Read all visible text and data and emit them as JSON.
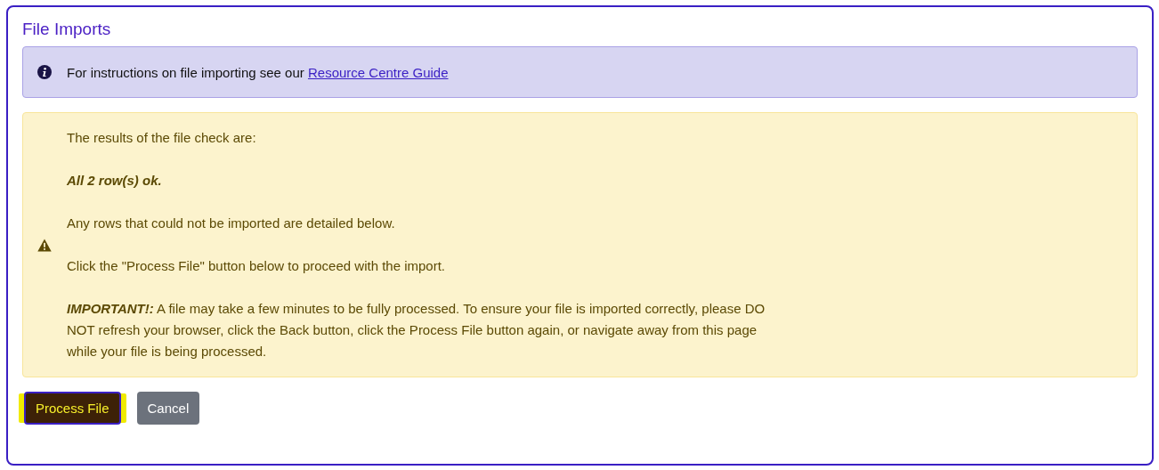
{
  "panel": {
    "title": "File Imports"
  },
  "info_alert": {
    "text": "For instructions on file importing see our",
    "link": "Resource Centre Guide"
  },
  "warning_alert": {
    "paragraphs": [
      {
        "kind": "plain",
        "text": "The results of the file check are:"
      },
      {
        "kind": "emphasis",
        "text": "All 2 row(s) ok."
      },
      {
        "kind": "plain",
        "text": "Any rows that could not be imported are detailed below."
      },
      {
        "kind": "plain",
        "text": "Click the \"Process File\" button below to proceed with the import."
      },
      {
        "kind": "plain",
        "text": "**IMPORTANT!:** A file may take a few minutes to be fully processed. To ensure your file is imported correctly, please DO NOT refresh your browser, click the Back button, click the Process File button again, or navigate away from this page while your file is being processed."
      }
    ]
  },
  "buttons": [
    {
      "kind": "primary",
      "label": "Process File",
      "focused": true
    },
    {
      "kind": "secondary",
      "label": "Cancel",
      "focused": false
    }
  ]
}
